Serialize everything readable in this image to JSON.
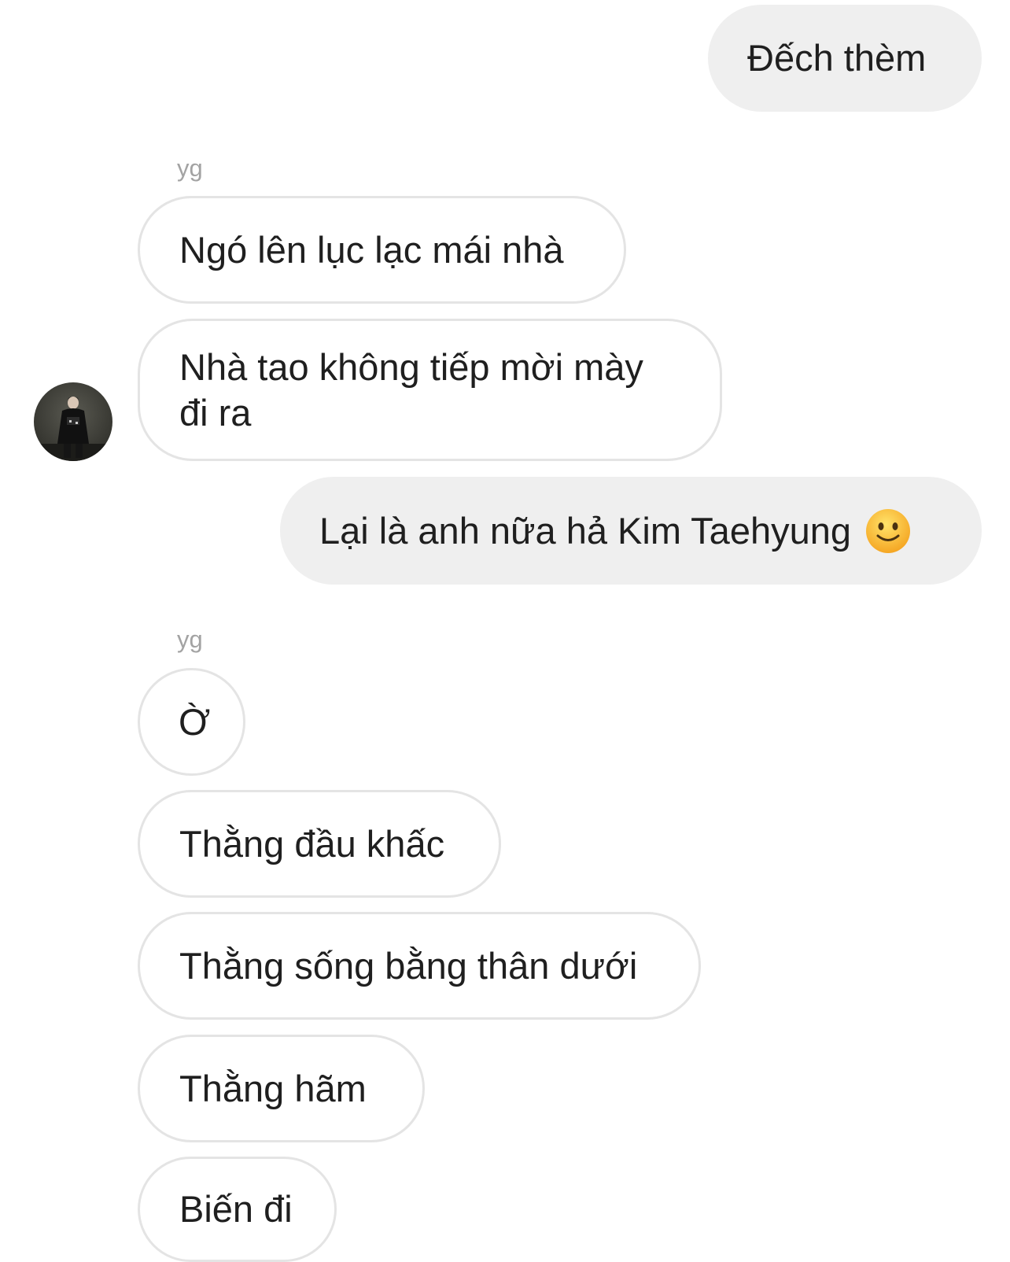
{
  "messages": {
    "m1": {
      "text": "Đếch thèm"
    },
    "sender1": "yg",
    "m2": {
      "text": "Ngó lên lục lạc mái nhà"
    },
    "m3": {
      "text": "Nhà tao không tiếp mời mày đi ra"
    },
    "m4": {
      "text": "Lại là anh nữa hả Kim Taehyung",
      "emoji": "slightly-smiling-face-icon"
    },
    "sender2": "yg",
    "m5": {
      "text": "Ờ"
    },
    "m6": {
      "text": "Thằng đầu khấc"
    },
    "m7": {
      "text": "Thằng sống bằng thân dưới"
    },
    "m8": {
      "text": "Thằng hãm"
    },
    "m9": {
      "text": "Biến đi"
    }
  },
  "colors": {
    "outgoing_bubble": "#efefef",
    "incoming_border": "#e4e4e4",
    "sender_label": "#a3a3a3",
    "text": "#1f1f1f"
  }
}
